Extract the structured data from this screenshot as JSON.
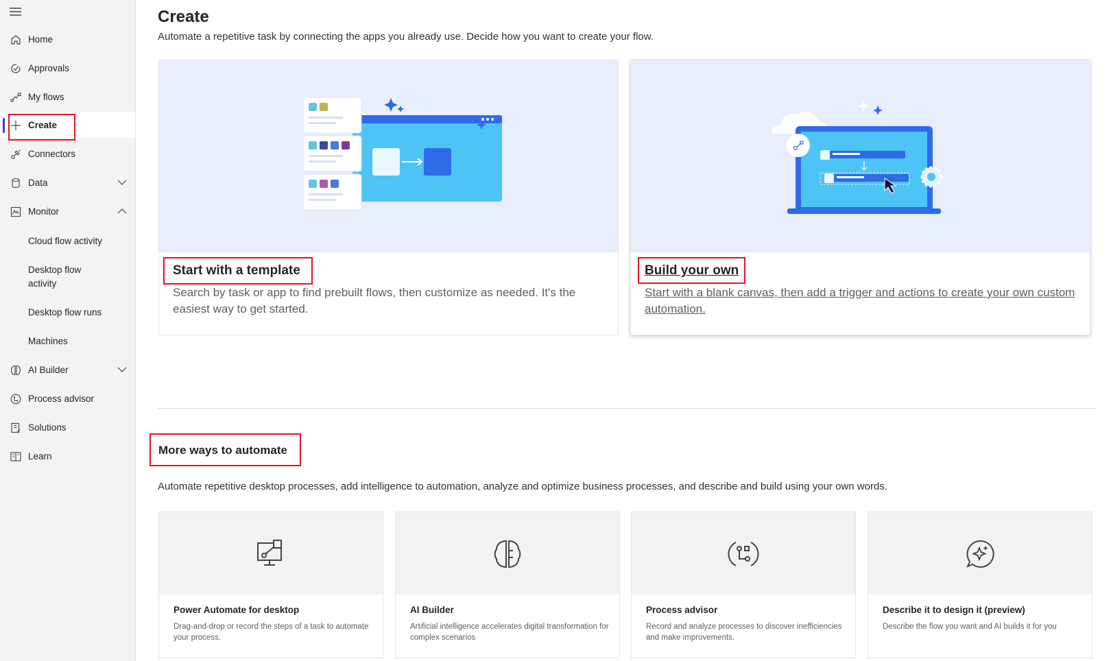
{
  "sidebar": {
    "items": [
      {
        "label": "Home",
        "icon": "home-icon"
      },
      {
        "label": "Approvals",
        "icon": "approvals-icon"
      },
      {
        "label": "My flows",
        "icon": "flows-icon"
      },
      {
        "label": "Create",
        "icon": "plus-icon",
        "active": true
      },
      {
        "label": "Connectors",
        "icon": "connectors-icon"
      },
      {
        "label": "Data",
        "icon": "database-icon",
        "expandable": true
      },
      {
        "label": "Monitor",
        "icon": "monitor-icon",
        "expanded": true
      }
    ],
    "monitor_children": [
      "Cloud flow activity",
      "Desktop flow activity",
      "Desktop flow runs",
      "Machines"
    ],
    "items_after": [
      {
        "label": "AI Builder",
        "icon": "ai-builder-icon",
        "expandable": true
      },
      {
        "label": "Process advisor",
        "icon": "process-advisor-icon"
      },
      {
        "label": "Solutions",
        "icon": "solutions-icon"
      },
      {
        "label": "Learn",
        "icon": "learn-icon"
      }
    ]
  },
  "main": {
    "title": "Create",
    "subtitle": "Automate a repetitive task by connecting the apps you already use. Decide how you want to create your flow.",
    "cards": [
      {
        "title": "Start with a template",
        "description": "Search by task or app to find prebuilt flows, then customize as needed. It's the easiest way to get started."
      },
      {
        "title": "Build your own",
        "description": "Start with a blank canvas, then add a trigger and actions to create your own custom automation."
      }
    ],
    "more": {
      "title": "More ways to automate",
      "subtitle": "Automate repetitive desktop processes, add intelligence to automation, analyze and optimize business processes, and describe and build using your own words.",
      "cards": [
        {
          "title": "Power Automate for desktop",
          "description": "Drag-and-drop or record the steps of a task to automate your process.",
          "icon": "desktop-flow-icon"
        },
        {
          "title": "AI Builder",
          "description": "Artificial intelligence accelerates digital transformation for complex scenarios",
          "icon": "ai-brain-icon"
        },
        {
          "title": "Process advisor",
          "description": "Record and analyze processes to discover inefficiencies and make improvements.",
          "icon": "process-advisor-icon"
        },
        {
          "title": "Describe it to design it (preview)",
          "description": "Describe the flow you want and AI builds it for you",
          "icon": "chat-sparkle-icon"
        }
      ]
    }
  },
  "colors": {
    "accent": "#2f3fd8",
    "highlight": "#e81123",
    "art_bg": "#e8eefc"
  }
}
